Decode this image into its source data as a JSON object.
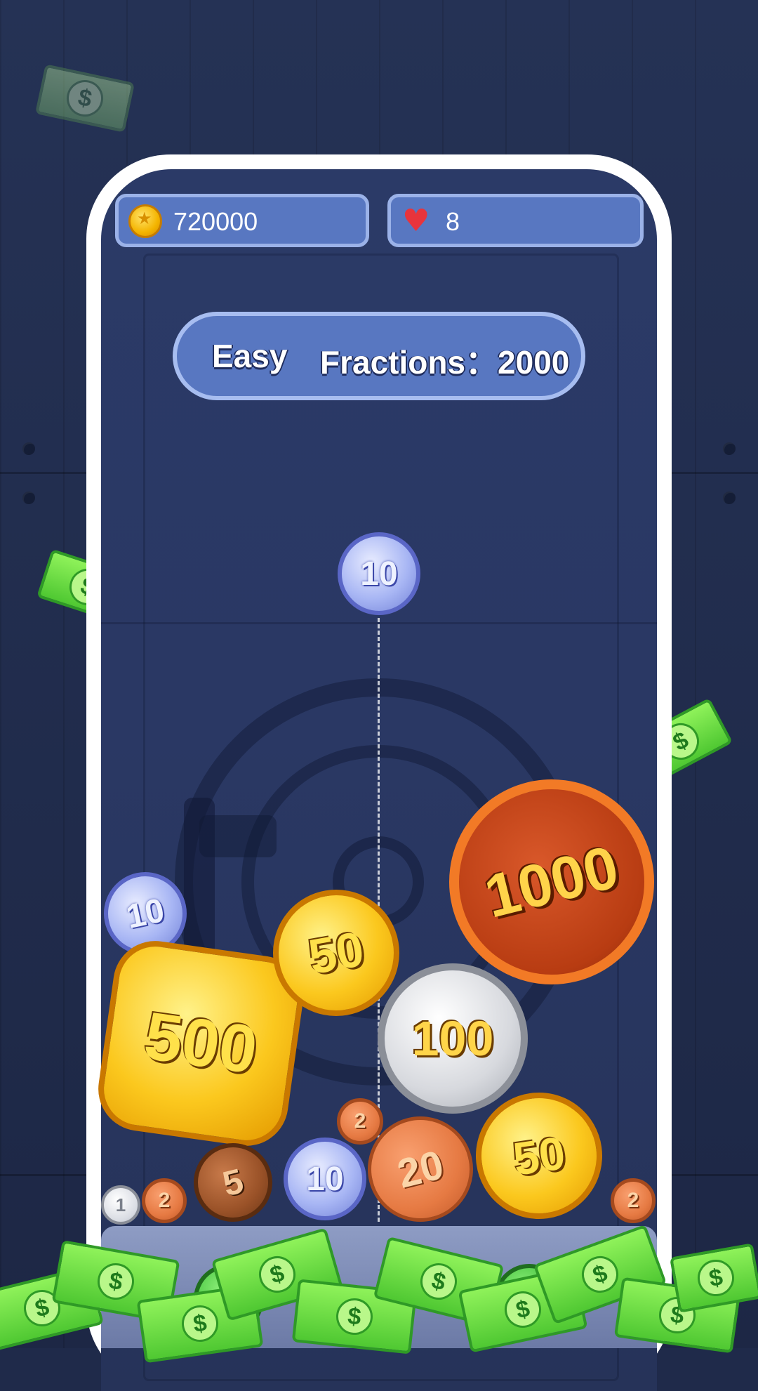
{
  "hud": {
    "coins": "720000",
    "coins_icon": "gold-coin-icon",
    "lives": "8",
    "lives_icon": "heart-icon"
  },
  "level": {
    "difficulty": "Easy",
    "score_label": "Fractions：2000"
  },
  "next_coin": {
    "value": "10"
  },
  "coins": [
    {
      "value": "10",
      "type": "blue"
    },
    {
      "value": "500",
      "type": "gold"
    },
    {
      "value": "50",
      "type": "gold"
    },
    {
      "value": "1000",
      "type": "red"
    },
    {
      "value": "100",
      "type": "silver"
    },
    {
      "value": "50",
      "type": "gold"
    },
    {
      "value": "20",
      "type": "copper"
    },
    {
      "value": "2",
      "type": "copper"
    },
    {
      "value": "10",
      "type": "blue"
    },
    {
      "value": "5",
      "type": "bronze"
    },
    {
      "value": "2",
      "type": "copper"
    },
    {
      "value": "1",
      "type": "white"
    },
    {
      "value": "2",
      "type": "copper"
    }
  ],
  "bill_symbol": "$",
  "colors": {
    "background": "#1f2a4a",
    "hud_panel": "#5877c1",
    "phone_frame": "#ffffff",
    "cash_green": "#4fc832"
  }
}
